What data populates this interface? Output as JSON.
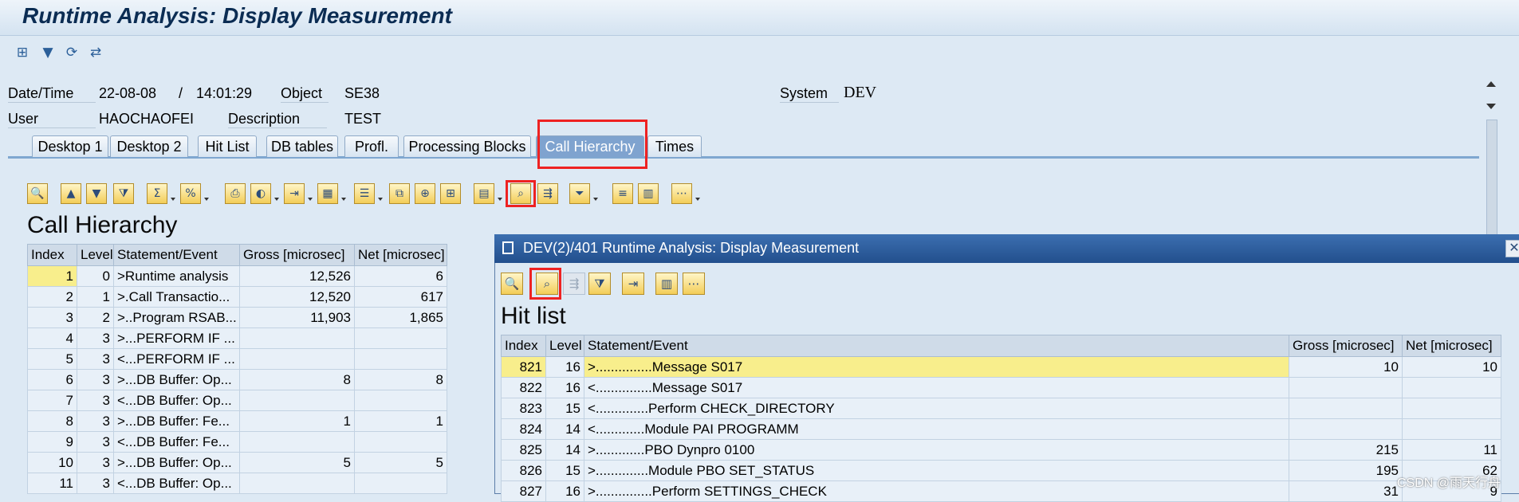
{
  "window": {
    "title": "Runtime Analysis: Display Measurement"
  },
  "header": {
    "datetime_label": "Date/Time",
    "date": "22-08-08",
    "sep": "/",
    "time": "14:01:29",
    "object_label": "Object",
    "object_value": "SE38",
    "system_label": "System",
    "system_value": "DEV",
    "user_label": "User",
    "user_value": "HAOCHAOFEI",
    "description_label": "Description",
    "description_value": "TEST"
  },
  "tabs": [
    "Desktop 1",
    "Desktop 2",
    "Hit List",
    "DB tables",
    "Profl.",
    "Processing Blocks",
    "Call Hierarchy",
    "Times"
  ],
  "active_tab": "Call Hierarchy",
  "call_hierarchy": {
    "title": "Call Hierarchy",
    "columns": [
      "Index",
      "Level",
      "Statement/Event",
      "Gross [microsec]",
      "Net [microsec]"
    ],
    "rows": [
      [
        "1",
        "0",
        ">Runtime analysis",
        "12,526",
        "6"
      ],
      [
        "2",
        "1",
        ">.Call Transactio...",
        "12,520",
        "617"
      ],
      [
        "3",
        "2",
        ">..Program RSAB...",
        "11,903",
        "1,865"
      ],
      [
        "4",
        "3",
        ">...PERFORM IF ...",
        "",
        ""
      ],
      [
        "5",
        "3",
        "<...PERFORM IF ...",
        "",
        ""
      ],
      [
        "6",
        "3",
        ">...DB Buffer: Op...",
        "8",
        "8"
      ],
      [
        "7",
        "3",
        "<...DB Buffer: Op...",
        "",
        ""
      ],
      [
        "8",
        "3",
        ">...DB Buffer: Fe...",
        "1",
        "1"
      ],
      [
        "9",
        "3",
        "<...DB Buffer: Fe...",
        "",
        ""
      ],
      [
        "10",
        "3",
        ">...DB Buffer: Op...",
        "5",
        "5"
      ],
      [
        "11",
        "3",
        "<...DB Buffer: Op...",
        "",
        ""
      ]
    ]
  },
  "popup": {
    "title": "DEV(2)/401 Runtime Analysis: Display Measurement",
    "close_glyph": "✕",
    "hit_list_title": "Hit list",
    "columns": [
      "Index",
      "Level",
      "Statement/Event",
      "Gross [microsec]",
      "Net [microsec]"
    ],
    "rows": [
      [
        "821",
        "16",
        ">...............Message S017",
        "10",
        "10"
      ],
      [
        "822",
        "16",
        "<...............Message S017",
        "",
        ""
      ],
      [
        "823",
        "15",
        "<..............Perform CHECK_DIRECTORY",
        "",
        ""
      ],
      [
        "824",
        "14",
        "<.............Module PAI PROGRAMM",
        "",
        ""
      ],
      [
        "825",
        "14",
        ">.............PBO Dynpro 0100",
        "215",
        "11"
      ],
      [
        "826",
        "15",
        ">..............Module PBO SET_STATUS",
        "195",
        "62"
      ],
      [
        "827",
        "16",
        ">...............Perform SETTINGS_CHECK",
        "31",
        "9"
      ]
    ]
  },
  "watermark": "CSDN @雨天行舟",
  "colors": {
    "highlight_red": "#e22222",
    "selected_row": "#f8ee8c",
    "popup_title_bg": "#2d5e9f"
  }
}
